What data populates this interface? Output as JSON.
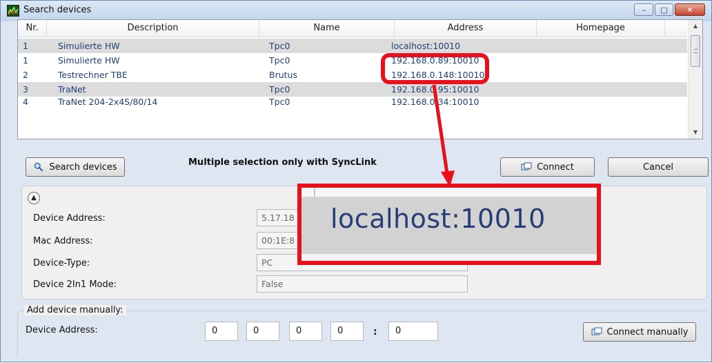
{
  "window": {
    "title": "Search devices",
    "minimize_glyph": "–",
    "maximize_glyph": "□",
    "close_glyph": "✕"
  },
  "table": {
    "columns": [
      "Nr.",
      "Description",
      "Name",
      "Address",
      "Homepage"
    ],
    "rows": [
      {
        "nr": "1",
        "description": "Simulierte HW",
        "name": "Tpc0",
        "address": "localhost:10010",
        "homepage": "",
        "selected": true
      },
      {
        "nr": "1",
        "description": "Simulierte HW",
        "name": "Tpc0",
        "address": "192.168.0.89:10010",
        "homepage": "",
        "selected": false
      },
      {
        "nr": "2",
        "description": "Testrechner TBE",
        "name": "Brutus",
        "address": "192.168.0.148:10010",
        "homepage": "",
        "selected": false
      },
      {
        "nr": "3",
        "description": "TraNet",
        "name": "Tpc0",
        "address": "192.168.0.95:10010",
        "homepage": "",
        "selected": true
      },
      {
        "nr": "4",
        "description": "TraNet 204-2x4S/80/14",
        "name": "Tpc0",
        "address": "192.168.0.34:10010",
        "homepage": "",
        "selected": false
      }
    ]
  },
  "buttons": {
    "search_devices": "Search devices",
    "connect": "Connect",
    "cancel": "Cancel",
    "connect_manually": "Connect manually"
  },
  "hint": "Multiple selection only with SyncLink",
  "details": {
    "device_address_label": "Device Address:",
    "device_address_value": "5.17.18",
    "mac_address_label": "Mac Address:",
    "mac_address_value": "00:1E:8",
    "device_type_label": "Device-Type:",
    "device_type_value": "PC",
    "mode_label": "Device 2In1 Mode:",
    "mode_value": "False"
  },
  "manual": {
    "legend": "Add device manually:",
    "address_label": "Device Address:",
    "octets": [
      "0",
      "0",
      "0",
      "0"
    ],
    "port": "0",
    "separator": ":"
  },
  "annotation": {
    "zoom_text": "localhost:10010",
    "color": "#e8101b"
  },
  "colors": {
    "link_text": "#1e3f74",
    "selection": "#dcdcdc",
    "title_gradient_top": "#dbe7f5"
  }
}
